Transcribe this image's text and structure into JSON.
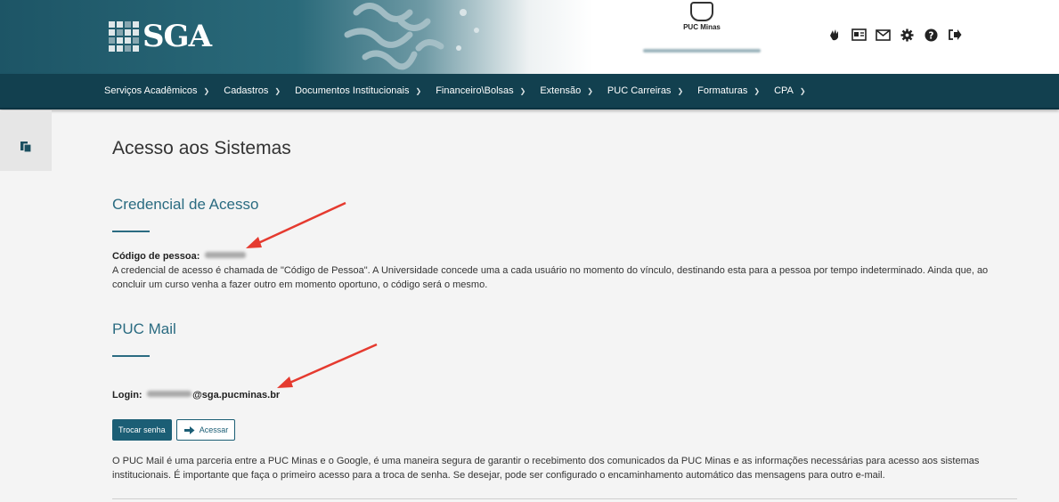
{
  "header": {
    "logo_text": "SGA",
    "brand_name": "PUC Minas",
    "icons": [
      "sign-language-icon",
      "id-card-icon",
      "envelope-icon",
      "gear-icon",
      "help-icon",
      "logout-icon"
    ]
  },
  "nav": {
    "items": [
      {
        "label": "Serviços Acadêmicos"
      },
      {
        "label": "Cadastros"
      },
      {
        "label": "Documentos Institucionais"
      },
      {
        "label": "Financeiro\\Bolsas"
      },
      {
        "label": "Extensão"
      },
      {
        "label": "PUC Carreiras"
      },
      {
        "label": "Formaturas"
      },
      {
        "label": "CPA"
      }
    ]
  },
  "page": {
    "title": "Acesso aos Sistemas"
  },
  "credencial": {
    "heading": "Credencial de Acesso",
    "label": "Código de pessoa:",
    "description": "A credencial de acesso é chamada de \"Código de Pessoa\". A Universidade concede uma a cada usuário no momento do vínculo, destinando esta para a pessoa por tempo indeterminado. Ainda que, ao concluir um curso venha a fazer outro em momento oportuno, o código será o mesmo."
  },
  "mail": {
    "heading": "PUC Mail",
    "login_label": "Login:",
    "login_domain": "@sga.pucminas.br",
    "change_password_button": "Trocar senha",
    "access_button": "Acessar",
    "description": "O PUC Mail é uma parceria entre a PUC Minas e o Google, é uma maneira segura de garantir o recebimento dos comunicados da PUC Minas e as informações necessárias para acesso aos sistemas institucionais. É importante que faça o primeiro acesso para a troca de senha. Se desejar, pode ser configurado o encaminhamento automático das mensagens para outro e-mail."
  },
  "colors": {
    "header": "#1b4f60",
    "nav": "#12404f",
    "accent": "#2a6b81",
    "annotation_arrow": "#e53a2f"
  }
}
